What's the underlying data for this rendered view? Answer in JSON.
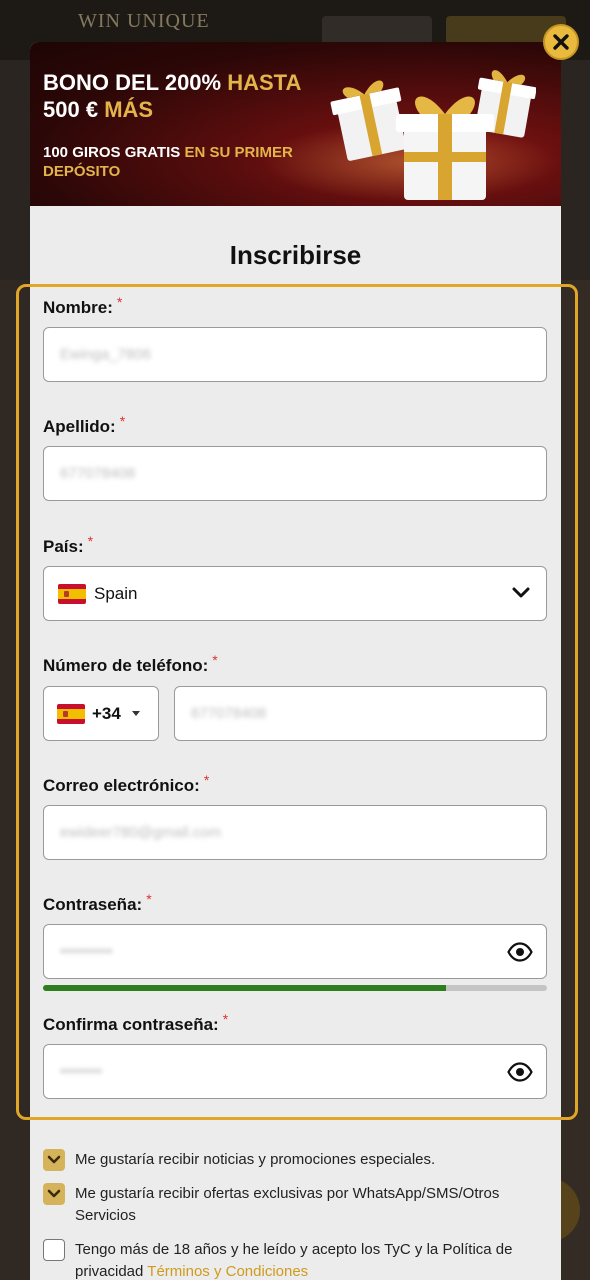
{
  "background_site": {
    "logo": "WIN UNIQUE"
  },
  "banner": {
    "title_white_1": "BONO DEL 200%",
    "title_gold_1": "HASTA",
    "title_white_2": "500 €",
    "title_gold_2": "MÁS",
    "sub_white": "100 GIROS GRATIS",
    "sub_gold": "EN SU PRIMER DEPÓSITO"
  },
  "form": {
    "title": "Inscribirse",
    "required_mark": "*",
    "fields": {
      "first_name": {
        "label": "Nombre:",
        "value": "Ewinga_7806"
      },
      "last_name": {
        "label": "Apellido:",
        "value": "677078408"
      },
      "country": {
        "label": "País:",
        "value": "Spain",
        "flag": "spain-flag-icon"
      },
      "phone": {
        "label": "Número de teléfono:",
        "code": "+34",
        "value": "677078408"
      },
      "email": {
        "label": "Correo electrónico:",
        "value": "ewideer780@gmail.com"
      },
      "password": {
        "label": "Contraseña:",
        "value": "••••••••••",
        "strength": 0.8
      },
      "confirm_password": {
        "label": "Confirma contraseña:",
        "value": "••••••••"
      }
    }
  },
  "consents": [
    {
      "checked": true,
      "text": "Me gustaría recibir noticias y promociones especiales."
    },
    {
      "checked": true,
      "text": "Me gustaría recibir ofertas exclusivas por WhatsApp/SMS/Otros Servicios"
    },
    {
      "checked": false,
      "text": "Tengo más de 18 años y he leído y acepto los TyC y la Política de privacidad",
      "link": "Términos y Condiciones"
    }
  ],
  "colors": {
    "accent": "#e0a628",
    "strength_fill": "#2e7d1f",
    "close_button": "#e9ba3d"
  }
}
